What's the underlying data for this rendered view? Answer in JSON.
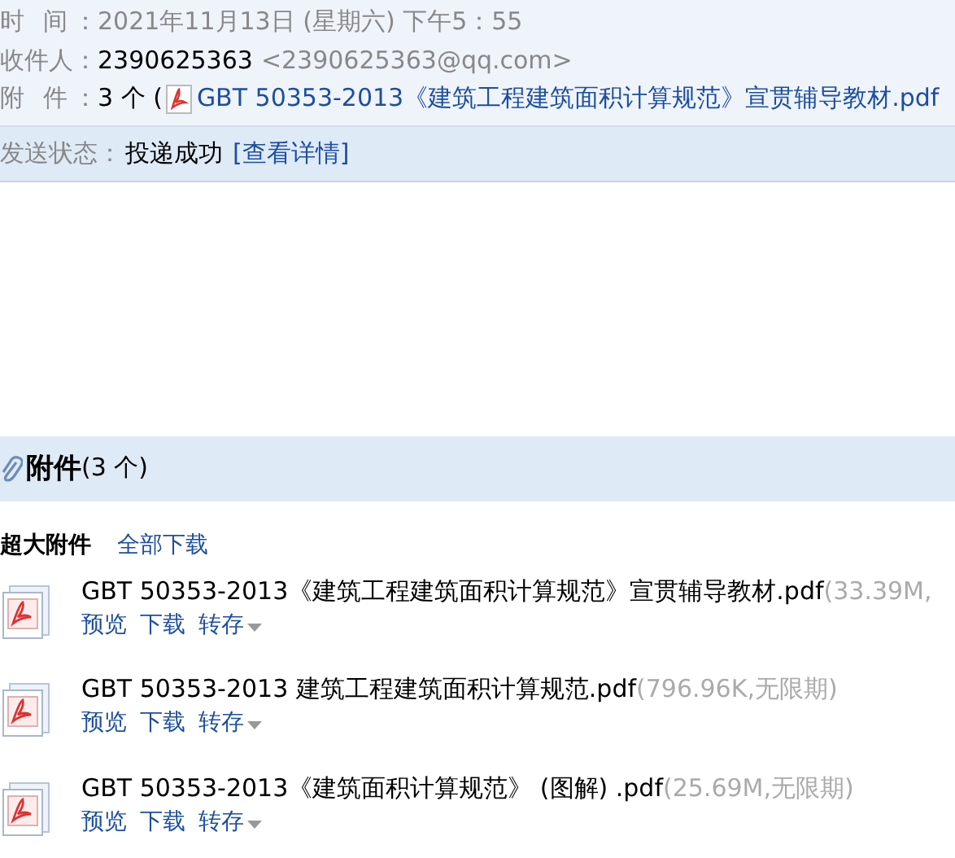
{
  "header": {
    "fields": [
      {
        "label": "时 间：",
        "value": "2021年11月13日 (星期六) 下午5：55",
        "kind": "muted"
      },
      {
        "label": "收件人：",
        "value": "2390625363",
        "extra": "<2390625363@qq.com>",
        "kind": "recipient"
      },
      {
        "label": "附 件：",
        "value": "3 个 (",
        "link": "GBT 50353-2013《建筑工程建筑面积计算规范》宣贯辅导教材.pdf",
        "kind": "attachment"
      }
    ]
  },
  "status": {
    "label": "发送状态：",
    "value": "投递成功",
    "link": "[查看详情]"
  },
  "attachments": {
    "title": "附件",
    "count": "(3 个)",
    "section": "超大附件",
    "download_all": "全部下载",
    "items": [
      {
        "name": "GBT 50353-2013《建筑工程建筑面积计算规范》宣贯辅导教材.pdf",
        "meta": "(33.39M,",
        "actions": [
          "预览",
          "下载",
          "转存"
        ]
      },
      {
        "name": "GBT 50353-2013 建筑工程建筑面积计算规范.pdf",
        "meta": "(796.96K,无限期)",
        "actions": [
          "预览",
          "下载",
          "转存"
        ]
      },
      {
        "name": "GBT 50353-2013《建筑面积计算规范》 (图解) .pdf",
        "meta": "(25.69M,无限期)",
        "actions": [
          "预览",
          "下载",
          "转存"
        ]
      }
    ]
  }
}
